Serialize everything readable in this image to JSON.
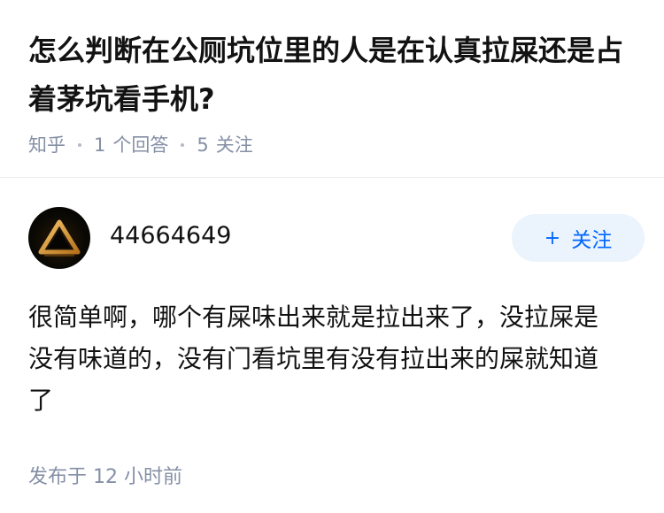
{
  "question": {
    "title": "怎么判断在公厕坑位里的人是在认真拉屎还是占着茅坑看手机?",
    "source": "知乎",
    "answers_count": "1",
    "answers_label": "个回答",
    "followers_count": "5",
    "followers_label": "关注"
  },
  "answer": {
    "author_name": "44664649",
    "follow_label": "关注",
    "follow_icon": "plus-icon",
    "avatar_icon": "triangle-logo-icon",
    "content": "很简单啊，哪个有屎味出来就是拉出来了，没拉屎是没有味道的，没有门看坑里有没有拉出来的屎就知道了",
    "published": "发布于  12 小时前"
  },
  "colors": {
    "text": "#121212",
    "meta": "#8590a6",
    "accent": "#0066ff",
    "follow_bg": "#ebf3fc"
  }
}
